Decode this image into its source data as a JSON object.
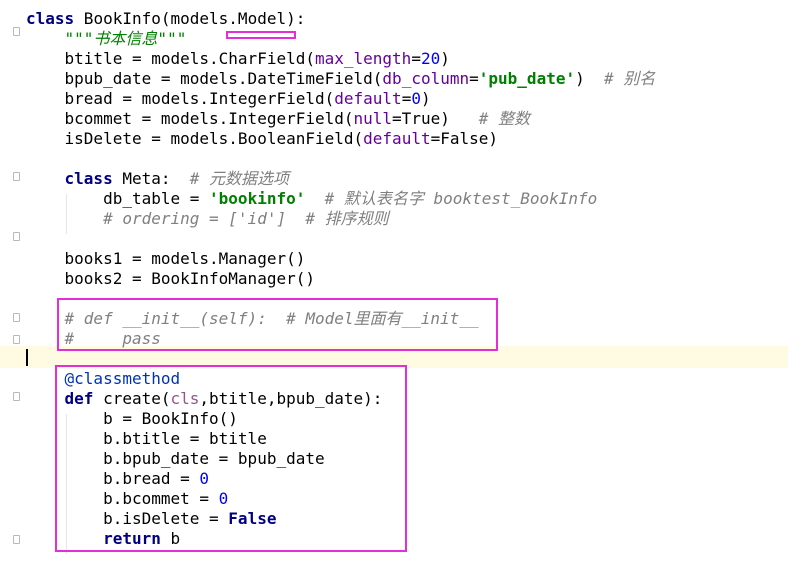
{
  "editor": {
    "language": "python",
    "highlight_color": "#e22fd8",
    "current_line_color": "#fefbe2",
    "lines": [
      {
        "tokens": [
          {
            "t": "class",
            "c": "k"
          },
          {
            "t": " BookInfo(models.Model):"
          }
        ]
      },
      {
        "tokens": [
          {
            "t": "    "
          },
          {
            "t": "\"\"\"书本信息\"\"\"",
            "c": "d"
          }
        ]
      },
      {
        "tokens": [
          {
            "t": "    btitle = models.CharField("
          },
          {
            "t": "max_length",
            "c": "kw"
          },
          {
            "t": "="
          },
          {
            "t": "20",
            "c": "n"
          },
          {
            "t": ")"
          }
        ]
      },
      {
        "tokens": [
          {
            "t": "    bpub_date = models.DateTimeField("
          },
          {
            "t": "db_column",
            "c": "kw"
          },
          {
            "t": "="
          },
          {
            "t": "'pub_date'",
            "c": "s"
          },
          {
            "t": ")  "
          },
          {
            "t": "# 别名",
            "c": "c"
          }
        ]
      },
      {
        "tokens": [
          {
            "t": "    bread = models.IntegerField("
          },
          {
            "t": "default",
            "c": "kw"
          },
          {
            "t": "="
          },
          {
            "t": "0",
            "c": "n"
          },
          {
            "t": ")"
          }
        ]
      },
      {
        "tokens": [
          {
            "t": "    bcommet = models.IntegerField("
          },
          {
            "t": "null",
            "c": "kw"
          },
          {
            "t": "=True)   "
          },
          {
            "t": "# 整数",
            "c": "c"
          }
        ]
      },
      {
        "tokens": [
          {
            "t": "    isDelete = models.BooleanField("
          },
          {
            "t": "default",
            "c": "kw"
          },
          {
            "t": "=False)"
          }
        ]
      },
      {
        "tokens": []
      },
      {
        "tokens": [
          {
            "t": "    "
          },
          {
            "t": "class",
            "c": "k"
          },
          {
            "t": " Meta:  "
          },
          {
            "t": "# 元数据选项",
            "c": "c"
          }
        ]
      },
      {
        "tokens": [
          {
            "t": "        db_table = "
          },
          {
            "t": "'bookinfo'",
            "c": "s"
          },
          {
            "t": "  "
          },
          {
            "t": "# 默认表名字 booktest_BookInfo",
            "c": "c"
          }
        ]
      },
      {
        "tokens": [
          {
            "t": "        "
          },
          {
            "t": "# ordering = ['id']  # 排序规则",
            "c": "c"
          }
        ]
      },
      {
        "tokens": []
      },
      {
        "tokens": [
          {
            "t": "    books1 = models.Manager()"
          }
        ]
      },
      {
        "tokens": [
          {
            "t": "    books2 = BookInfoManager()"
          }
        ]
      },
      {
        "tokens": []
      },
      {
        "tokens": [
          {
            "t": "    "
          },
          {
            "t": "# def __init__(self):  # Model里面有__init__",
            "c": "c"
          }
        ]
      },
      {
        "tokens": [
          {
            "t": "    "
          },
          {
            "t": "#     pass",
            "c": "c"
          }
        ]
      },
      {
        "tokens": []
      },
      {
        "tokens": [
          {
            "t": "    "
          },
          {
            "t": "@classmethod",
            "c": "dec"
          }
        ]
      },
      {
        "tokens": [
          {
            "t": "    "
          },
          {
            "t": "def",
            "c": "k"
          },
          {
            "t": " create("
          },
          {
            "t": "cls",
            "c": "cl"
          },
          {
            "t": ",btitle,bpub_date):"
          }
        ]
      },
      {
        "tokens": [
          {
            "t": "        b = BookInfo()"
          }
        ]
      },
      {
        "tokens": [
          {
            "t": "        b.btitle = btitle"
          }
        ]
      },
      {
        "tokens": [
          {
            "t": "        b.bpub_date = bpub_date"
          }
        ]
      },
      {
        "tokens": [
          {
            "t": "        b.bread = "
          },
          {
            "t": "0",
            "c": "n"
          }
        ]
      },
      {
        "tokens": [
          {
            "t": "        b.bcommet = "
          },
          {
            "t": "0",
            "c": "n"
          }
        ]
      },
      {
        "tokens": [
          {
            "t": "        b.isDelete = "
          },
          {
            "t": "False",
            "c": "k"
          }
        ]
      },
      {
        "tokens": [
          {
            "t": "        "
          },
          {
            "t": "return",
            "c": "k"
          },
          {
            "t": " b"
          }
        ]
      }
    ]
  }
}
